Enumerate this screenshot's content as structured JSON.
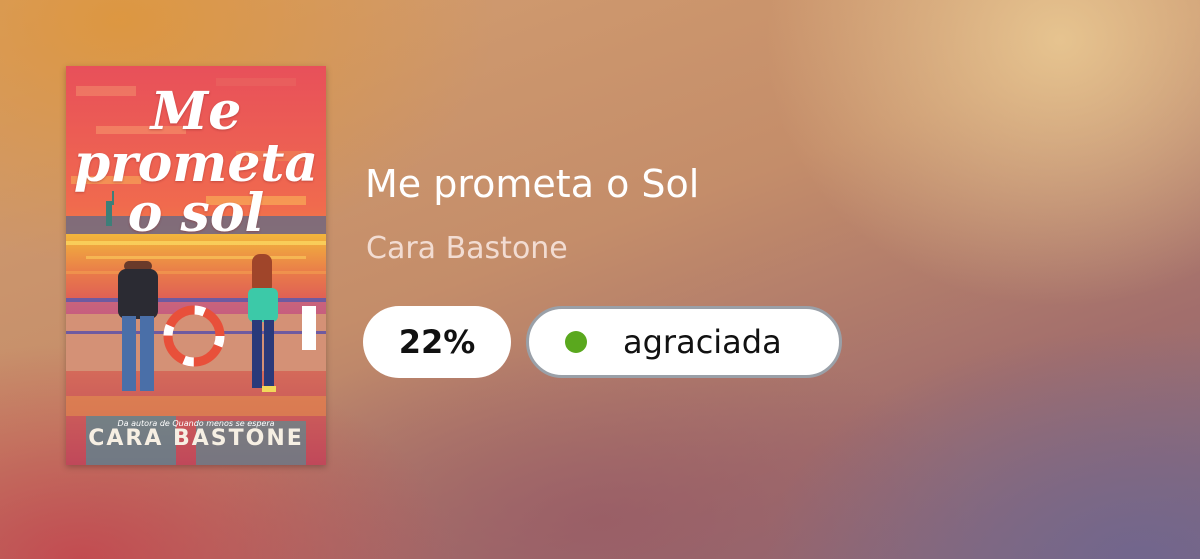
{
  "book": {
    "title": "Me prometa o Sol",
    "author": "Cara Bastone",
    "cover": {
      "title_lines": [
        "Me",
        "prometa",
        "o sol"
      ],
      "tagline": "Da autora de Quando menos se espera",
      "author": "CARA BASTONE"
    }
  },
  "progress": {
    "label": "22%",
    "value": 22
  },
  "status": {
    "label": "agraciada",
    "dot_color": "#5aa81e"
  },
  "icons": {
    "status_dot": "status-dot-icon",
    "publisher_logo": "publisher-logo-icon"
  }
}
